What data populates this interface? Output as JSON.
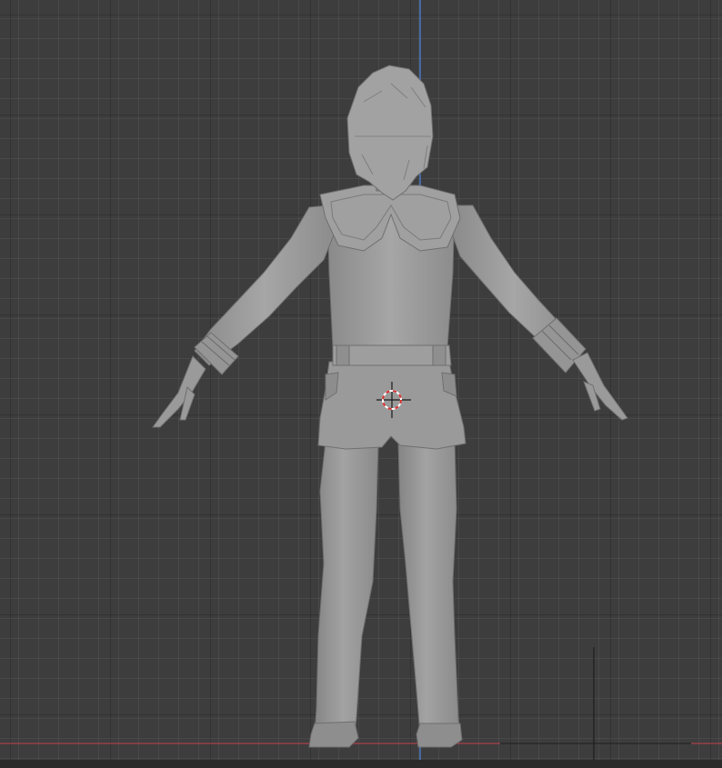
{
  "viewport": {
    "view_mode": "front-orthographic",
    "background_color": "#3d3d3d",
    "grid_visible": true
  },
  "axes": {
    "z_axis_color": "#4a78c4",
    "x_axis_color": "#c8404a"
  },
  "model": {
    "description_icon": "character-mesh-icon",
    "mesh_color": "#9c9c9c",
    "shading": "solid-matcap"
  },
  "cursor": {
    "icon": "3d-cursor-icon",
    "colors": [
      "#ffffff",
      "#d83030"
    ]
  }
}
